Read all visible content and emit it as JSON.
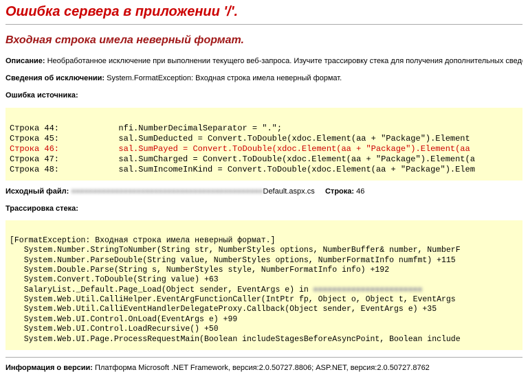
{
  "title": "Ошибка сервера в приложении '/'.",
  "subtitle": "Входная строка имела неверный формат.",
  "description": {
    "label": "Описание:",
    "text": "Необработанное исключение при выполнении текущего веб-запроса. Изучите трассировку стека для получения дополнительных сведений о д"
  },
  "exception": {
    "label": "Сведения об исключении:",
    "text": "System.FormatException: Входная строка имела неверный формат."
  },
  "source_error": {
    "label": "Ошибка источника:",
    "lines": [
      {
        "n": "Строка 44:",
        "code": "            nfi.NumberDecimalSeparator = \".\";"
      },
      {
        "n": "Строка 45:",
        "code": "            sal.SumDeducted = Convert.ToDouble(xdoc.Element(aa + \"Package\").Element "
      },
      {
        "n": "Строка 46:",
        "code": "            sal.SumPayed = Convert.ToDouble(xdoc.Element(aa + \"Package\").Element(aa "
      },
      {
        "n": "Строка 47:",
        "code": "            sal.SumCharged = Convert.ToDouble(xdoc.Element(aa + \"Package\").Element(a"
      },
      {
        "n": "Строка 48:",
        "code": "            sal.SumIncomeInKind = Convert.ToDouble(xdoc.Element(aa + \"Package\").Elem"
      }
    ],
    "error_index": 2
  },
  "source_file": {
    "label": "Исходный файл:",
    "path_hidden": "■■■■■■■■■■■■■■■■■■■■■■■■■■■■■■■■■■■■■■■■■■■■",
    "path_tail": "Default.aspx.cs",
    "line_label": "Строка:",
    "line_no": "46"
  },
  "stack": {
    "label": "Трассировка стека:",
    "text": "\n[FormatException: Входная строка имела неверный формат.]\n   System.Number.StringToNumber(String str, NumberStyles options, NumberBuffer& number, NumberF\n   System.Number.ParseDouble(String value, NumberStyles options, NumberFormatInfo numfmt) +115\n   System.Double.Parse(String s, NumberStyles style, NumberFormatInfo info) +192\n   System.Convert.ToDouble(String value) +63\n   SalaryList._Default.Page_Load(Object sender, EventArgs e) in ",
    "blur_inline": "■■■■■■■■■■■■■■■■■■■■■■■",
    "text2": "\n   System.Web.Util.CalliHelper.EventArgFunctionCaller(IntPtr fp, Object o, Object t, EventArgs \n   System.Web.Util.CalliEventHandlerDelegateProxy.Callback(Object sender, EventArgs e) +35\n   System.Web.UI.Control.OnLoad(EventArgs e) +99\n   System.Web.UI.Control.LoadRecursive() +50\n   System.Web.UI.Page.ProcessRequestMain(Boolean includeStagesBeforeAsyncPoint, Boolean include"
  },
  "version": {
    "label": "Информация о версии:",
    "text": "Платформа Microsoft .NET Framework, версия:2.0.50727.8806; ASP.NET, версия:2.0.50727.8762"
  }
}
